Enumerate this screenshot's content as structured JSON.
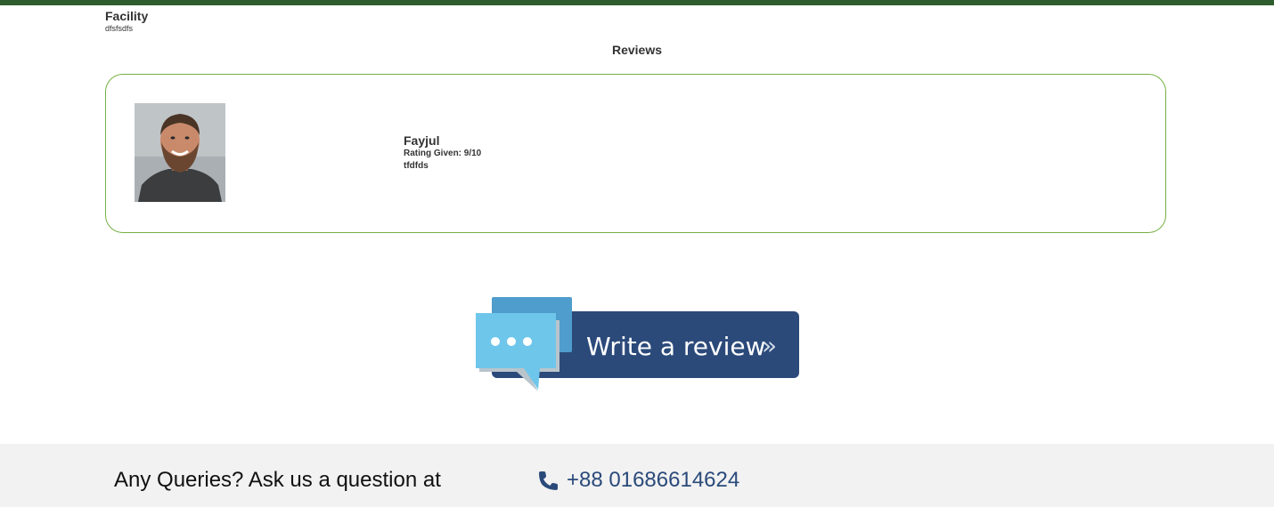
{
  "colors": {
    "top_bar": "#2e5e2e",
    "card_border": "#76b043",
    "footer_bg": "#f2f2f2",
    "phone_color": "#2a4a7a",
    "banner_dark": "#2b4a7a",
    "bubble_light": "#6ec6ea"
  },
  "facility": {
    "title": "Facility",
    "description": "dfsfsdfs"
  },
  "reviews": {
    "heading": "Reviews",
    "items": [
      {
        "name": "Fayjul",
        "rating": "Rating Given: 9/10",
        "text": "tfdfds",
        "avatar_icon": "user-photo"
      }
    ]
  },
  "write_review": {
    "label": "Write a review",
    "arrow": "»"
  },
  "footer": {
    "question": "Any Queries? Ask us a question at",
    "phone_icon": "phone-icon",
    "phone": "+88 01686614624"
  }
}
